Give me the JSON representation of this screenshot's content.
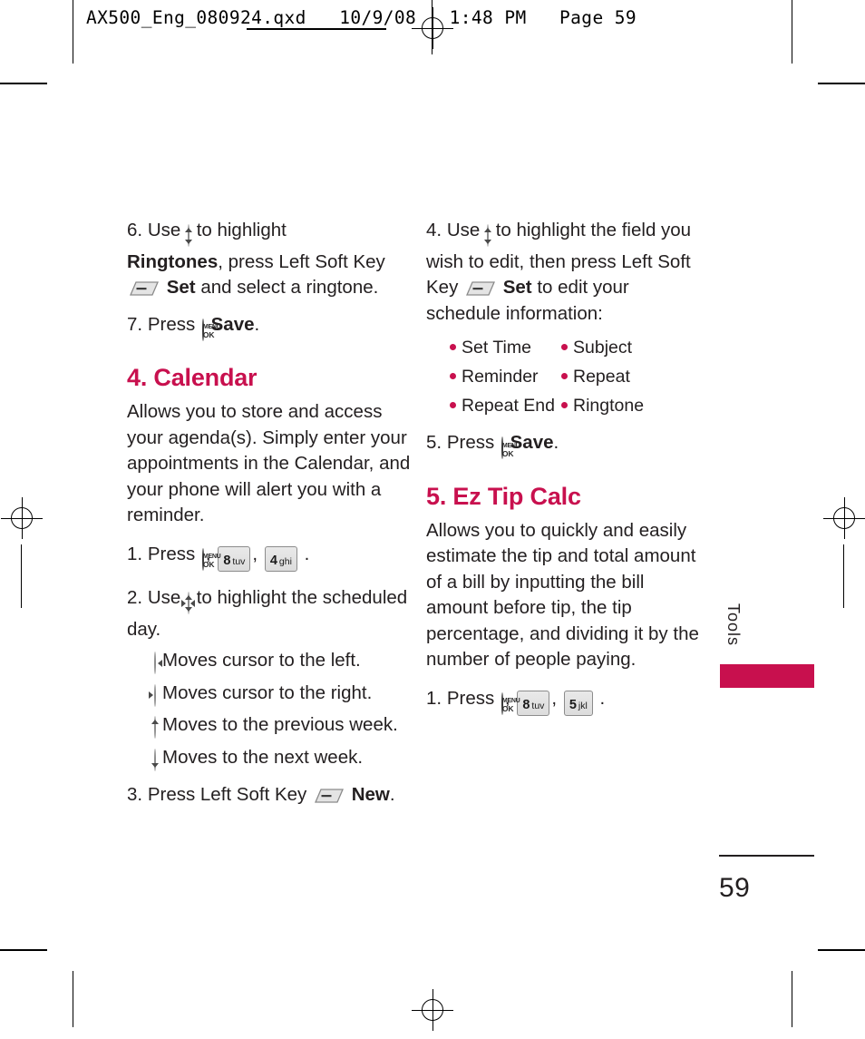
{
  "print_header": {
    "slug": "AX500_Eng_080924.qxd   10/9/08   1:48 PM   Page 59"
  },
  "left_column": {
    "step6": {
      "number": "6.",
      "text_a": "Use",
      "icon_nav": "nav-updown-key-icon",
      "text_b": "to highlight",
      "bold_ringtones": "Ringtones",
      "text_c": ", press Left Soft Key",
      "icon_soft": "left-soft-key-icon",
      "bold_set": "Set",
      "text_d": "and select a ringtone."
    },
    "step7": {
      "number": "7.",
      "text_a": "Press",
      "icon_ok": "menu-ok-key-icon",
      "bold_save": "Save",
      "text_b": "."
    },
    "calendar_heading": "4. Calendar",
    "calendar_body": "Allows you to store and access your agenda(s). Simply enter your appointments in the Calendar, and your phone will alert you with a reminder.",
    "step1": {
      "number": "1.",
      "text_a": "Press",
      "icon_ok": "menu-ok-key-icon",
      "comma1": ",",
      "key8": {
        "digit": "8",
        "letters": "tuv"
      },
      "comma2": ",",
      "key4": {
        "digit": "4",
        "letters": "ghi"
      },
      "period": "."
    },
    "step2": {
      "number": "2.",
      "text_a": "Use",
      "icon_nav": "nav-4way-key-icon",
      "text_b": "to highlight the scheduled day."
    },
    "cursor_moves": [
      {
        "icon": "nav-left-key-icon",
        "label": "Moves cursor to the left."
      },
      {
        "icon": "nav-right-key-icon",
        "label": "Moves cursor to the right."
      },
      {
        "icon": "nav-up-key-icon",
        "label": "Moves to the previous week."
      },
      {
        "icon": "nav-down-key-icon",
        "label": "Moves to the next week."
      }
    ],
    "step3": {
      "number": "3.",
      "text_a": "Press Left Soft Key",
      "icon_soft": "left-soft-key-icon",
      "bold_new": "New",
      "period": "."
    }
  },
  "right_column": {
    "step4": {
      "number": "4.",
      "text_a": "Use",
      "icon_nav": "nav-updown-key-icon",
      "text_b": "to highlight the field you wish to edit, then press Left Soft Key",
      "icon_soft": "left-soft-key-icon",
      "bold_set": "Set",
      "text_c": "to edit your schedule information:"
    },
    "schedule_fields": [
      "Set Time",
      "Subject",
      "Reminder",
      "Repeat",
      "Repeat End",
      "Ringtone"
    ],
    "step5": {
      "number": "5.",
      "text_a": "Press",
      "icon_ok": "menu-ok-key-icon",
      "bold_save": "Save",
      "period": "."
    },
    "eztip_heading": "5. Ez Tip Calc",
    "eztip_body": "Allows you to quickly and easily estimate the tip and total amount of a bill by inputting the bill amount before tip, the tip percentage, and dividing it by the number of people paying.",
    "step1": {
      "number": "1.",
      "text_a": "Press",
      "icon_ok": "menu-ok-key-icon",
      "comma1": ",",
      "key8": {
        "digit": "8",
        "letters": "tuv"
      },
      "comma2": ",",
      "key5": {
        "digit": "5",
        "letters": "jkl"
      },
      "period": "."
    }
  },
  "side_tab": {
    "label": "Tools",
    "color": "#C8104E"
  },
  "footer": {
    "page_number": "59"
  },
  "theme": {
    "accent": "#C8104E",
    "text": "#231F20"
  }
}
